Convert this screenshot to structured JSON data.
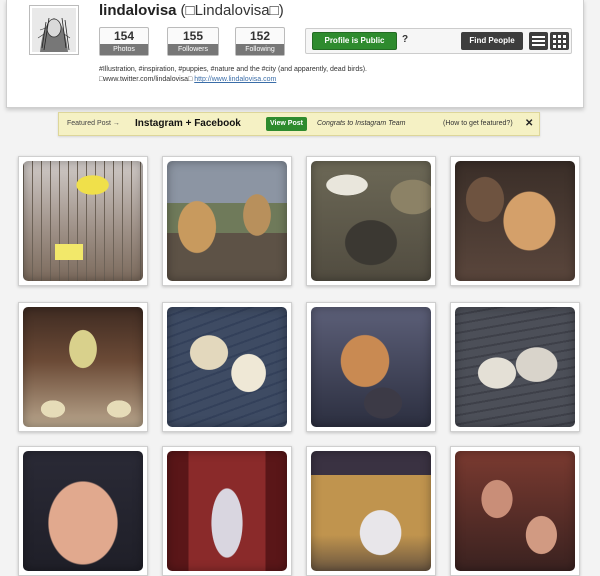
{
  "profile": {
    "username": "lindalovisa",
    "full_name": "(□Lindalovisa□)",
    "avatar_icon": "sketch-portrait-avatar"
  },
  "stats": {
    "photos": {
      "count": "154",
      "label": "Photos"
    },
    "followers": {
      "count": "155",
      "label": "Followers"
    },
    "following": {
      "count": "152",
      "label": "Following"
    }
  },
  "actions": {
    "public_label": "Profile is Public",
    "help_label": "?",
    "find_people_label": "Find People",
    "list_view_icon": "list-view-icon",
    "grid_view_icon": "grid-view-icon"
  },
  "bio": {
    "line1": "#Illustration, #inspiration, #puppies, #nature and the #city (and apparently, dead birds).",
    "line2_text": "□www.twitter.com/lindalovisa□ ",
    "line2_link": "http://www.lindalovisa.com"
  },
  "featured": {
    "label": "Featured Post →",
    "title": "Instagram + Facebook",
    "view_label": "View Post",
    "congrats": "Congrats to Instagram Team",
    "how_link": "(How to get featured?)",
    "close": "✕"
  },
  "colors": {
    "public_green": "#2e8b2e",
    "dark_button": "#3d3d3d",
    "banner_yellow": "#f5f1c4",
    "link_blue": "#3a6da8"
  },
  "photos": [
    {
      "subject": "yellow sign in bare forest"
    },
    {
      "subject": "two ponies in paddock"
    },
    {
      "subject": "cat on rocks"
    },
    {
      "subject": "man holding orange cat"
    },
    {
      "subject": "dinner table with tulips"
    },
    {
      "subject": "two golden dogs on deck"
    },
    {
      "subject": "orange cat in arms"
    },
    {
      "subject": "two dogs playing on deck"
    },
    {
      "subject": "smiling woman close-up"
    },
    {
      "subject": "religious painting"
    },
    {
      "subject": "white dog on table"
    },
    {
      "subject": "two people portrait"
    }
  ]
}
